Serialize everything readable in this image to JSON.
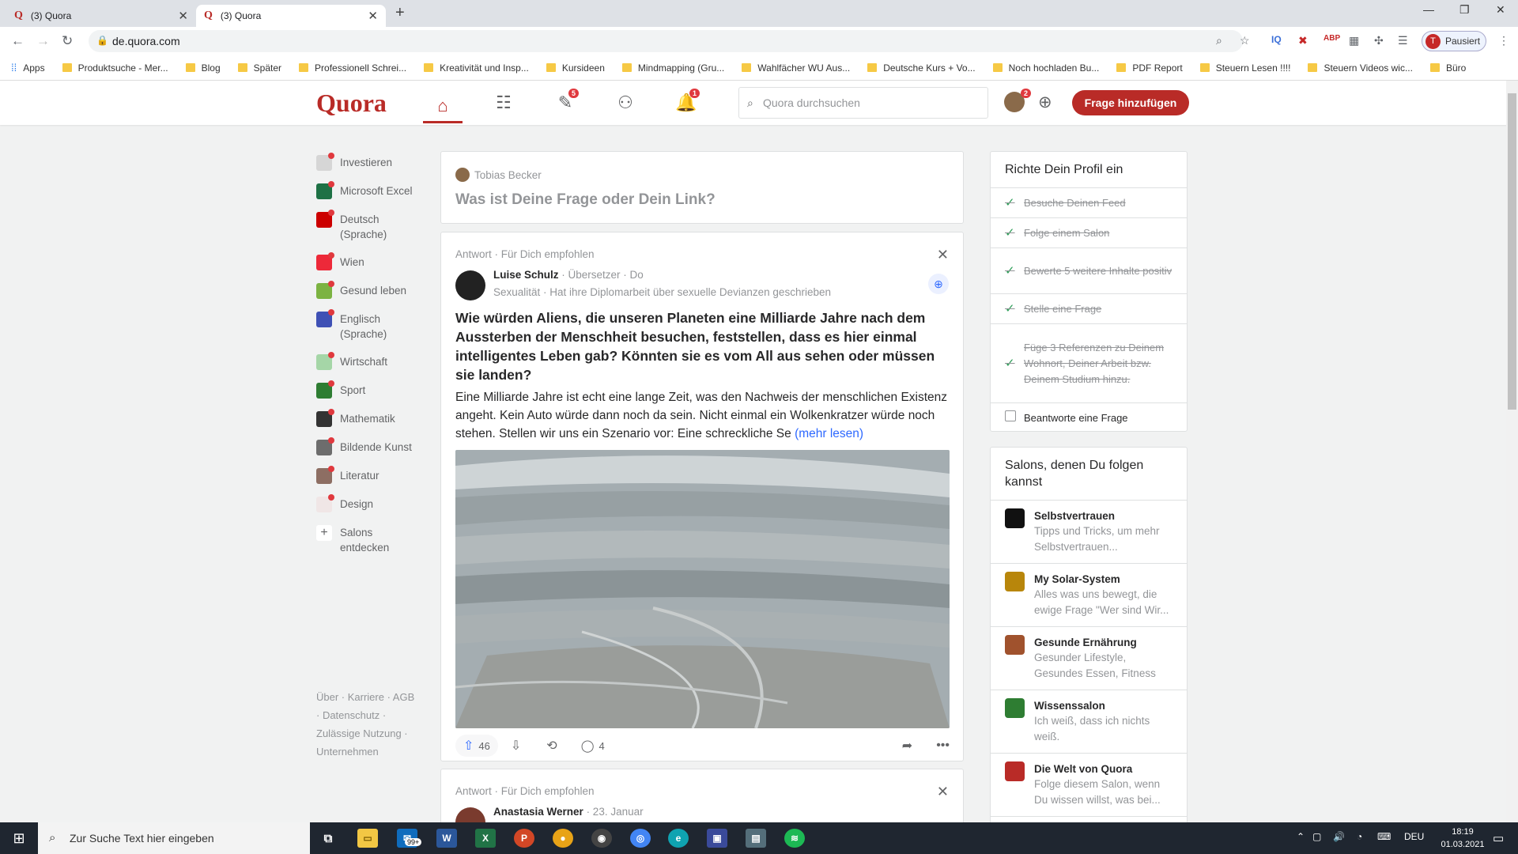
{
  "browser": {
    "tabs": [
      {
        "label": "(3) Quora"
      },
      {
        "label": "(3) Quora"
      }
    ],
    "url": "de.quora.com",
    "profile_label": "Pausiert",
    "profile_initial": "T",
    "bookmarks": [
      "Apps",
      "Produktsuche - Mer...",
      "Blog",
      "Später",
      "Professionell Schrei...",
      "Kreativität und Insp...",
      "Kursideen",
      "Mindmapping (Gru...",
      "Wahlfächer WU Aus...",
      "Deutsche Kurs + Vo...",
      "Noch hochladen Bu...",
      "PDF Report",
      "Steuern Lesen !!!!",
      "Steuern Videos wic...",
      "Büro"
    ]
  },
  "header": {
    "logo": "Quora",
    "badge_answer": "5",
    "badge_notifications": "1",
    "badge_user": "2",
    "search_placeholder": "Quora durchsuchen",
    "add_question": "Frage hinzufügen"
  },
  "sidebar": {
    "items": [
      {
        "label": "Investieren",
        "color": "#d6d6d6"
      },
      {
        "label": "Microsoft Excel",
        "color": "#1e7145"
      },
      {
        "label": "Deutsch (Sprache)",
        "color": "#cc0000"
      },
      {
        "label": "Wien",
        "color": "#ed2939"
      },
      {
        "label": "Gesund leben",
        "color": "#7cb342"
      },
      {
        "label": "Englisch (Sprache)",
        "color": "#3f51b5"
      },
      {
        "label": "Wirtschaft",
        "color": "#a5d6a7"
      },
      {
        "label": "Sport",
        "color": "#2e7d32"
      },
      {
        "label": "Mathematik",
        "color": "#333333"
      },
      {
        "label": "Bildende Kunst",
        "color": "#6d6d6d"
      },
      {
        "label": "Literatur",
        "color": "#8d6e63"
      },
      {
        "label": "Design",
        "color": "#f0e6e6"
      },
      {
        "label": "Salons entdecken",
        "color": "#ffffff"
      }
    ],
    "footer": "Über · Karriere · AGB · Datenschutz · Zulässige Nutzung · Unternehmen"
  },
  "ask": {
    "user": "Tobias Becker",
    "prompt": "Was ist Deine Frage oder Dein Link?"
  },
  "answer": {
    "context": "Antwort · Für Dich empfohlen",
    "author": "Luise Schulz",
    "author_meta": " · Übersetzer · Do",
    "credential": "Sexualität · Hat ihre Diplomarbeit über sexuelle Devianzen geschrieben",
    "question": "Wie würden Aliens, die unseren Planeten eine Milliarde Jahre nach dem Aussterben der Menschheit besuchen, feststellen, dass es hier einmal intelligentes Leben gab? Könnten sie es vom All aus sehen oder müssen sie landen?",
    "excerpt": "Eine Milliarde Jahre ist echt eine lange Zeit, was den Nachweis der menschlichen Existenz angeht. Kein Auto würde dann noch da sein. Nicht einmal ein Wolkenkratzer würde noch stehen. Stellen wir uns ein Szenario vor: Eine schreckliche Se",
    "more": "(mehr lesen)",
    "upvotes": "46",
    "comments": "4"
  },
  "answer2": {
    "context": "Antwort · Für Dich empfohlen",
    "author": "Anastasia Werner",
    "author_meta": " · 23. Januar"
  },
  "profile_setup": {
    "title": "Richte Dein Profil ein",
    "tasks": [
      {
        "label": "Besuche Deinen Feed",
        "done": true
      },
      {
        "label": "Folge einem Salon",
        "done": true
      },
      {
        "label": "Bewerte 5 weitere Inhalte positiv",
        "done": true
      },
      {
        "label": "Stelle eine Frage",
        "done": true
      },
      {
        "label": "Füge 3 Referenzen zu Deinem Wohnort, Deiner Arbeit bzw. Deinem Studium hinzu.",
        "done": true
      },
      {
        "label": "Beantworte eine Frage",
        "done": false
      }
    ]
  },
  "salons": {
    "title": "Salons, denen Du folgen kannst",
    "items": [
      {
        "name": "Selbstvertrauen",
        "desc": "Tipps und Tricks, um mehr Selbstvertrauen...",
        "color": "#111111"
      },
      {
        "name": "My Solar-System",
        "desc": "Alles was uns bewegt, die ewige Frage \"Wer sind Wir...",
        "color": "#b8860b"
      },
      {
        "name": "Gesunde Ernährung",
        "desc": "Gesunder Lifestyle, Gesundes Essen, Fitness",
        "color": "#a0522d"
      },
      {
        "name": "Wissenssalon",
        "desc": "Ich weiß, dass ich nichts weiß.",
        "color": "#2e7d32"
      },
      {
        "name": "Die Welt von Quora",
        "desc": "Folge diesem Salon, wenn Du wissen willst, was bei...",
        "color": "#b92b27"
      }
    ]
  },
  "taskbar": {
    "search_placeholder": "Zur Suche Text hier eingeben",
    "mail_badge": "99+",
    "lang": "DEU",
    "time": "18:19",
    "date": "01.03.2021"
  }
}
